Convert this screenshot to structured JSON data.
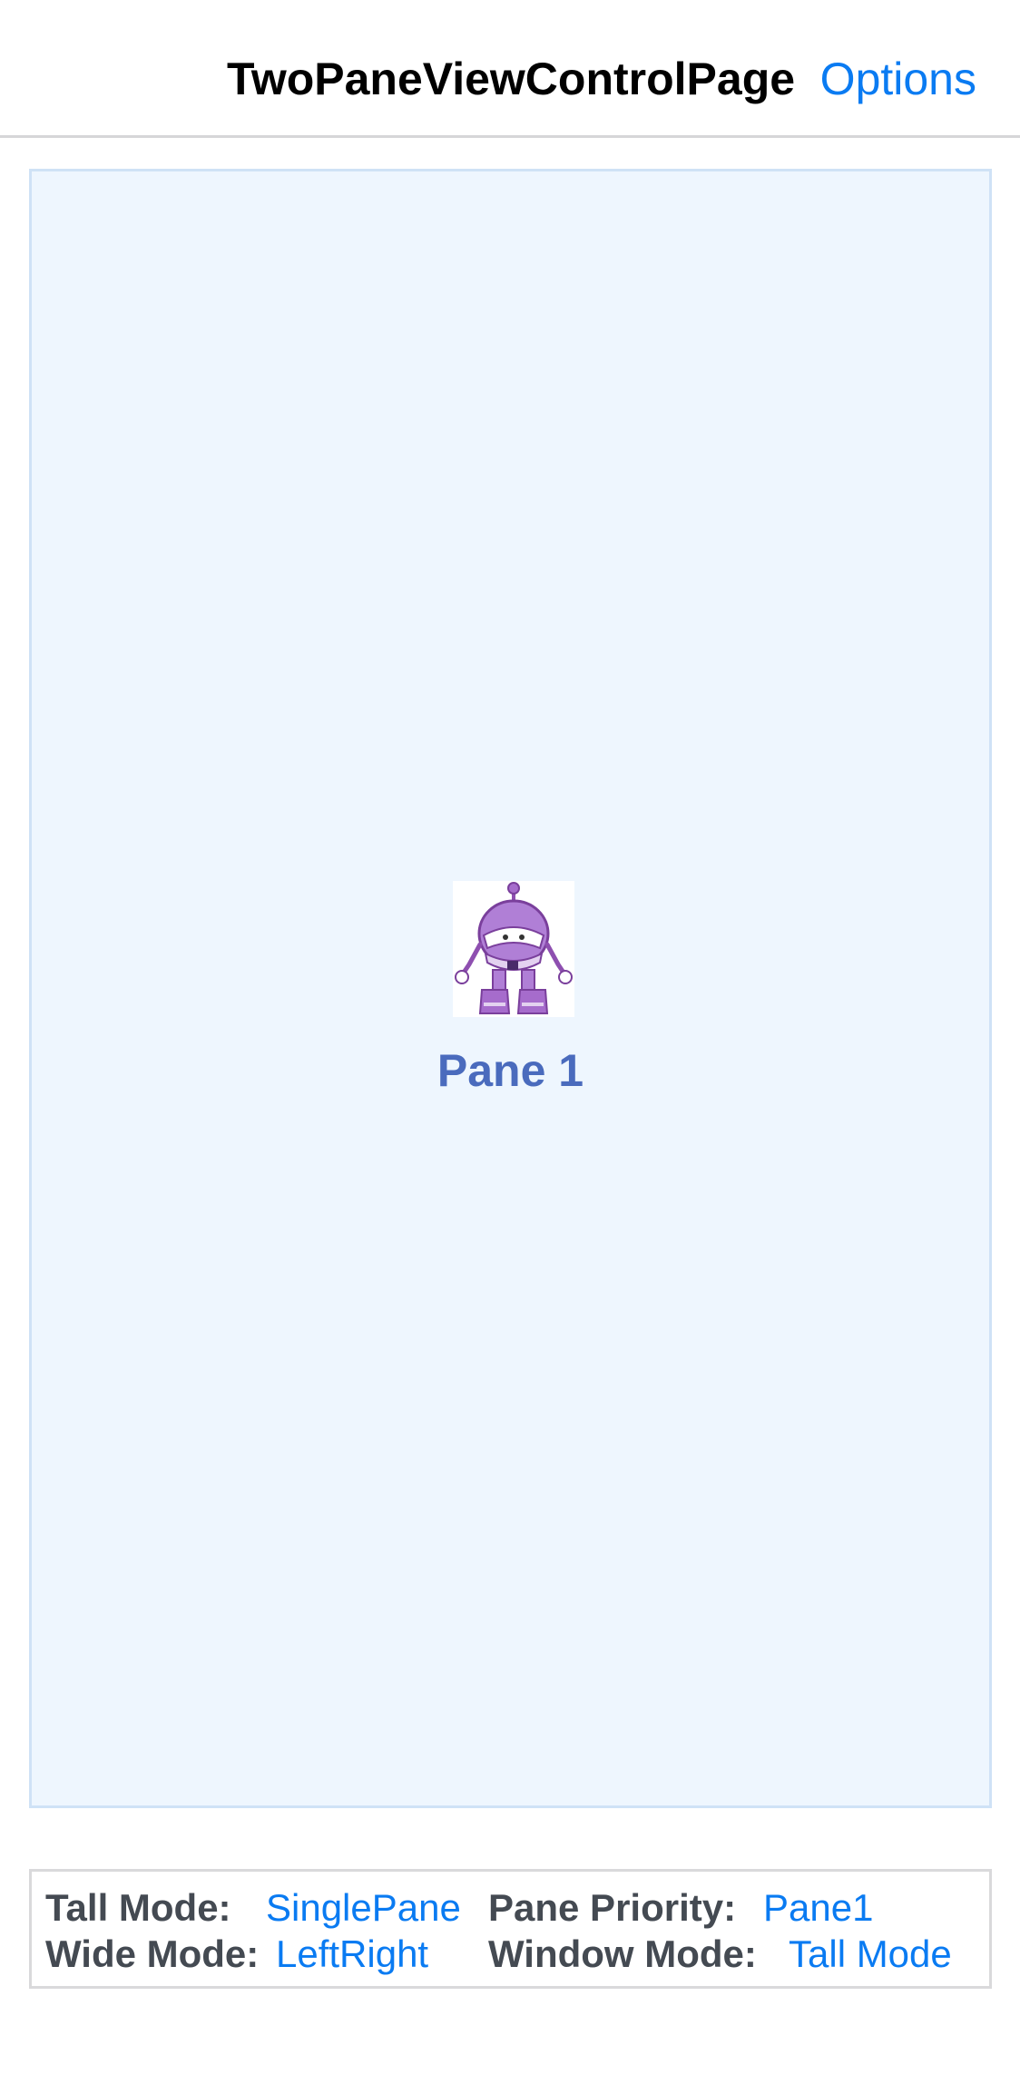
{
  "navbar": {
    "title": "TwoPaneViewControlPage",
    "options_label": "Options"
  },
  "pane": {
    "label": "Pane 1",
    "image_icon": "robot-mascot-icon"
  },
  "info": {
    "tall_mode_label": "Tall Mode:",
    "tall_mode_value": "SinglePane",
    "pane_priority_label": "Pane Priority:",
    "pane_priority_value": "Pane1",
    "wide_mode_label": "Wide Mode:",
    "wide_mode_value": "LeftRight",
    "window_mode_label": "Window Mode:",
    "window_mode_value": "Tall Mode"
  },
  "colors": {
    "accent": "#0a7bf2",
    "pane_background": "#eef6fe",
    "pane_label": "#4a6bbd",
    "robot": "#9b59b6"
  }
}
